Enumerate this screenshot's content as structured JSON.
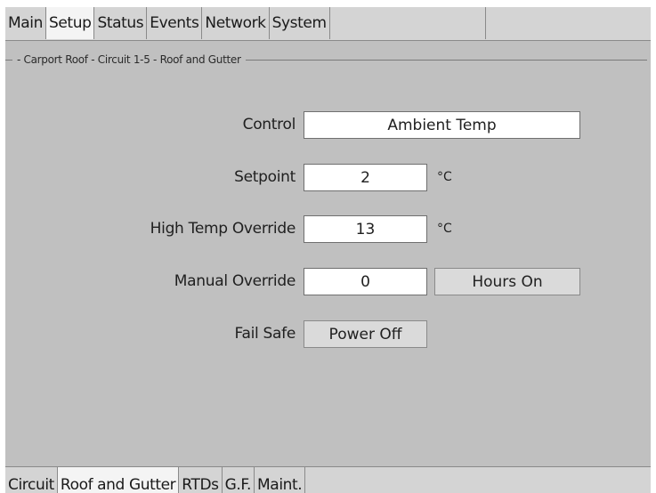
{
  "top_tabs": [
    "Main",
    "Setup",
    "Status",
    "Events",
    "Network",
    "System"
  ],
  "top_active": "Setup",
  "section_title": "- Carport Roof - Circuit 1-5 - Roof and Gutter",
  "form": {
    "control": {
      "label": "Control",
      "value": "Ambient Temp"
    },
    "setpoint": {
      "label": "Setpoint",
      "value": "2",
      "unit": "°C"
    },
    "high_temp_override": {
      "label": "High Temp Override",
      "value": "13",
      "unit": "°C"
    },
    "manual_override": {
      "label": "Manual Override",
      "value": "0",
      "button": "Hours On"
    },
    "fail_safe": {
      "label": "Fail Safe",
      "button": "Power Off"
    }
  },
  "bottom_tabs": [
    "Circuit",
    "Roof and Gutter",
    "RTDs",
    "G.F.",
    "Maint."
  ],
  "bottom_active": "Roof and Gutter"
}
